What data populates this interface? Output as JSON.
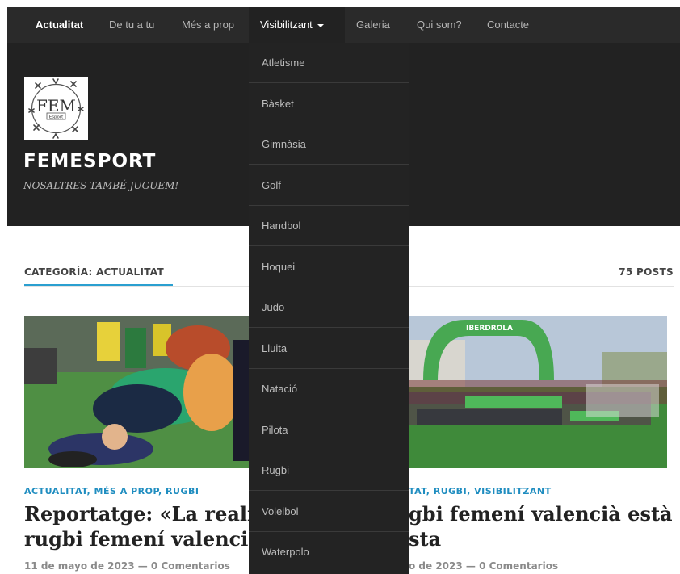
{
  "nav": {
    "items": [
      {
        "label": "Actualitat"
      },
      {
        "label": "De tu a tu"
      },
      {
        "label": "Més a prop"
      },
      {
        "label": "Visibilitzant"
      },
      {
        "label": "Galeria"
      },
      {
        "label": "Qui som?"
      },
      {
        "label": "Contacte"
      }
    ]
  },
  "dropdown": {
    "items": [
      {
        "label": "Atletisme"
      },
      {
        "label": "Bàsket"
      },
      {
        "label": "Gimnàsia"
      },
      {
        "label": "Golf"
      },
      {
        "label": "Handbol"
      },
      {
        "label": "Hoquei"
      },
      {
        "label": "Judo"
      },
      {
        "label": "Lluita"
      },
      {
        "label": "Natació"
      },
      {
        "label": "Pilota"
      },
      {
        "label": "Rugbi"
      },
      {
        "label": "Voleibol"
      },
      {
        "label": "Waterpolo"
      }
    ]
  },
  "site": {
    "logo_text": "FEM",
    "logo_subtext": "Esport",
    "title": "FEMESPORT",
    "tagline": "NOSALTRES TAMBÉ JUGUEM!"
  },
  "category": {
    "label": "CATEGORÍA: ACTUALITAT",
    "count": "75 POSTS"
  },
  "posts": [
    {
      "categories": "ACTUALITAT, MÉS A PROP, RUGBI",
      "title_line1": "Reportatge: «La realitat",
      "title_line2": "rugbi femení valencià»",
      "meta": "11 de mayo de 2023 — 0 Comentarios"
    },
    {
      "categories": "TAT, RUGBI, VISIBILITZANT",
      "title_line1": "gbi femení valencià està",
      "title_line2": "sta",
      "meta": "o de 2023 — 0 Comentarios",
      "banner_text": "IBERDROLA"
    }
  ],
  "colors": {
    "nav_bg": "#2a2a2a",
    "header_bg": "#222222",
    "dropdown_bg": "#232323",
    "accent": "#1f8dc0",
    "grass": "#3f8a3a"
  }
}
